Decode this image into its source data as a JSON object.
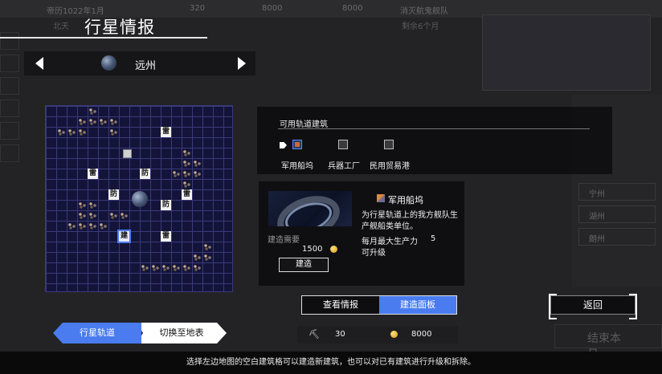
{
  "title": "行星情报",
  "planet": {
    "name": "远州"
  },
  "background": {
    "date": "帝历1022年1月",
    "location": "北天",
    "res1": "320",
    "res2": "8000",
    "res3": "8000",
    "mission": "消灭航鬼舰队",
    "mission_sub": "剩余6个月",
    "side_items": [
      "宁州",
      "湖州",
      "朗州"
    ],
    "end_turn": "结束本月"
  },
  "orbit_grid": {
    "buildings": [
      {
        "label": "雷",
        "col": 11,
        "row": 2
      },
      {
        "label": "雷",
        "col": 4,
        "row": 6
      },
      {
        "label": "防",
        "col": 9,
        "row": 6
      },
      {
        "label": "防",
        "col": 6,
        "row": 8
      },
      {
        "label": "雷",
        "col": 13,
        "row": 8
      },
      {
        "label": "防",
        "col": 11,
        "row": 9
      },
      {
        "label": "建",
        "col": 7,
        "row": 12,
        "selected": true
      },
      {
        "label": "雷",
        "col": 11,
        "row": 12
      }
    ]
  },
  "available": {
    "header": "可用轨道建筑",
    "items": [
      {
        "label": "军用船坞",
        "active": true
      },
      {
        "label": "兵器工厂",
        "active": false
      },
      {
        "label": "民用贸易港",
        "active": false
      }
    ]
  },
  "detail": {
    "name": "军用船坞",
    "desc": "为行星轨道上的我方舰队生产舰船类单位。",
    "stat_label": "每月最大生产力",
    "stat_value": "5",
    "upgrade": "可升级",
    "cost_label": "建造需要",
    "cost_value": "1500",
    "build_label": "建造"
  },
  "tabs": {
    "view": "查看情报",
    "build": "建造面板"
  },
  "back": "返回",
  "mode": {
    "orbit": "行星轨道",
    "surface": "切换至地表"
  },
  "resources": {
    "tools": "30",
    "money": "8000"
  },
  "hint": "选择左边地图的空白建筑格可以建造新建筑，也可以对已有建筑进行升级和拆除。",
  "colors": {
    "accent": "#4a7cf0",
    "grid_bg": "#14143a",
    "grid_line": "#3a3a7a"
  }
}
